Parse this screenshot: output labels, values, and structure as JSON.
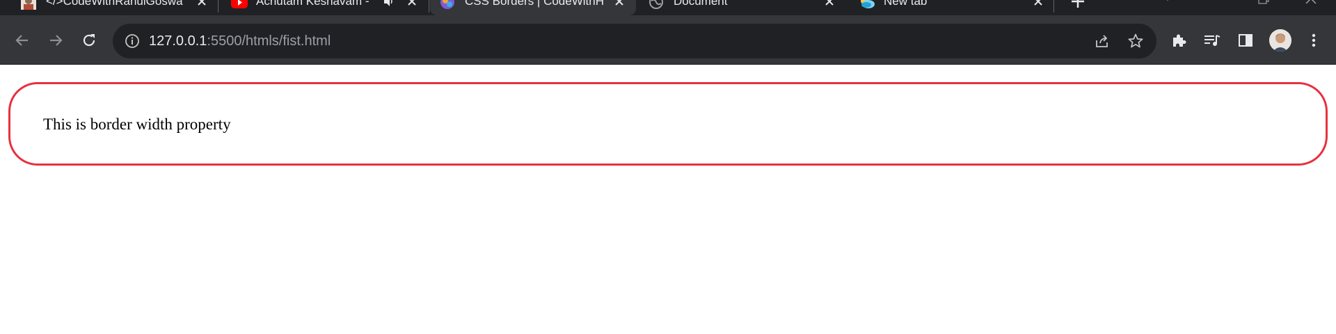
{
  "browser": {
    "tabs": [
      {
        "title": "</>CodeWithRahulGoswa",
        "favicon": "profile-photo-icon",
        "active": false
      },
      {
        "title": "Achutam Keshavam -",
        "favicon": "youtube-icon",
        "audio": "speaker-icon",
        "active": false
      },
      {
        "title": "CSS Borders | CodeWithH",
        "favicon": "codewithharry-icon",
        "active": true
      },
      {
        "title": "Document",
        "favicon": "globe-icon",
        "active": false
      },
      {
        "title": "New tab",
        "favicon": "edge-weather-icon",
        "active": false
      }
    ],
    "address_bar": {
      "host": "127.0.0.1",
      "rest": ":5500/htmls/fist.html"
    },
    "colors": {
      "tabstrip_bg": "#202124",
      "toolbar_bg": "#35363a",
      "omnibox_bg": "#202124",
      "icon": "#c4c7c5"
    }
  },
  "page": {
    "text": "This is border width property",
    "border_color": "#e8303f"
  }
}
